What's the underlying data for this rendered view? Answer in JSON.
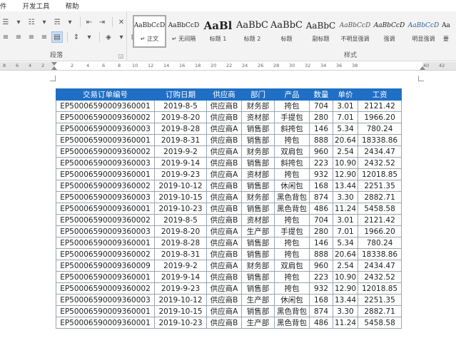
{
  "menubar": {
    "items": [
      "件",
      "开发工具",
      "帮助"
    ]
  },
  "ribbon": {
    "paragraph_group_label": "段落",
    "styles_group_label": "样式",
    "styles": [
      {
        "preview": "AaBbCcD",
        "name": "↵ 正文"
      },
      {
        "preview": "AaBbCcD",
        "name": "↵ 无间隔"
      },
      {
        "preview": "AaBl",
        "name": "标题 1"
      },
      {
        "preview": "AaBbC",
        "name": "标题 2"
      },
      {
        "preview": "AaBbC",
        "name": "标题"
      },
      {
        "preview": "AaBbC",
        "name": "副标题"
      },
      {
        "preview": "AaBbCcD",
        "name": "不明显强调"
      },
      {
        "preview": "AaBbCcD",
        "name": "强调"
      },
      {
        "preview": "AaBbCcD",
        "name": "明显强调"
      },
      {
        "preview": "Aa",
        "name": "要"
      }
    ]
  },
  "ruler": {
    "numbers": [
      "8",
      "6",
      "4",
      "2",
      "2",
      "4",
      "6",
      "8",
      "10",
      "12",
      "14",
      "16",
      "18",
      "20",
      "22",
      "24",
      "26",
      "28",
      "30",
      "32",
      "34",
      "36",
      "38",
      "40",
      "42"
    ]
  },
  "table": {
    "header_color": "#1f6fc5",
    "columns": [
      "交易订单编号",
      "订购日期",
      "供应商",
      "部门",
      "产品",
      "数量",
      "单价",
      "工资"
    ],
    "rows": [
      [
        "EP50006590009360001",
        "2019-8-5",
        "供应商B",
        "财务部",
        "挎包",
        "704",
        "3.01",
        "2121.42"
      ],
      [
        "EP50006590009360002",
        "2019-8-20",
        "供应商B",
        "资材部",
        "手提包",
        "280",
        "7.01",
        "1966.20"
      ],
      [
        "EP50006590009360003",
        "2019-8-28",
        "供应商A",
        "销售部",
        "斜挎包",
        "146",
        "5.34",
        "780.24"
      ],
      [
        "EP50006590009360001",
        "2019-8-31",
        "供应商B",
        "销售部",
        "挎包",
        "888",
        "20.64",
        "18338.86"
      ],
      [
        "EP50006590009360002",
        "2019-9-2",
        "供应商A",
        "财务部",
        "双肩包",
        "960",
        "2.54",
        "2434.47"
      ],
      [
        "EP50006590009360003",
        "2019-9-14",
        "供应商B",
        "销售部",
        "斜挎包",
        "223",
        "10.90",
        "2432.52"
      ],
      [
        "EP50006590009360001",
        "2019-9-23",
        "供应商A",
        "资材部",
        "挎包",
        "932",
        "12.90",
        "12018.85"
      ],
      [
        "EP50006590009360002",
        "2019-10-12",
        "供应商B",
        "销售部",
        "休闲包",
        "168",
        "13.44",
        "2251.35"
      ],
      [
        "EP50006590009360003",
        "2019-10-15",
        "供应商A",
        "财务部",
        "黑色背包",
        "874",
        "3.30",
        "2882.71"
      ],
      [
        "EP50006590009360001",
        "2019-10-23",
        "供应商B",
        "销售部",
        "黑色背包",
        "486",
        "11.24",
        "5458.58"
      ],
      [
        "EP50006590009360002",
        "2019-8-5",
        "供应商B",
        "资材部",
        "挎包",
        "704",
        "3.01",
        "2121.42"
      ],
      [
        "EP50006590009360003",
        "2019-8-20",
        "供应商A",
        "生产部",
        "手提包",
        "280",
        "7.01",
        "1966.20"
      ],
      [
        "EP50006590009360001",
        "2019-8-28",
        "供应商A",
        "销售部",
        "挎包",
        "146",
        "5.34",
        "780.24"
      ],
      [
        "EP50006590009360002",
        "2019-8-31",
        "供应商B",
        "销售部",
        "挎包",
        "888",
        "20.64",
        "18338.86"
      ],
      [
        "EP50006590009360009",
        "2019-9-2",
        "供应商A",
        "财务部",
        "双肩包",
        "960",
        "2.54",
        "2434.47"
      ],
      [
        "EP50006590009360001",
        "2019-9-14",
        "供应商B",
        "销售部",
        "挎包",
        "223",
        "10.90",
        "2432.52"
      ],
      [
        "EP50006590009360002",
        "2019-9-23",
        "供应商A",
        "销售部",
        "挎包",
        "932",
        "12.90",
        "12018.85"
      ],
      [
        "EP50006590009360003",
        "2019-10-12",
        "供应商B",
        "生产部",
        "休闲包",
        "168",
        "13.44",
        "2251.35"
      ],
      [
        "EP50006590009360001",
        "2019-10-15",
        "供应商A",
        "销售部",
        "黑色背包",
        "874",
        "3.30",
        "2882.71"
      ],
      [
        "EP50006590009360001",
        "2019-10-23",
        "供应商B",
        "生产部",
        "黑色背包",
        "486",
        "11.24",
        "5458.58"
      ]
    ]
  }
}
